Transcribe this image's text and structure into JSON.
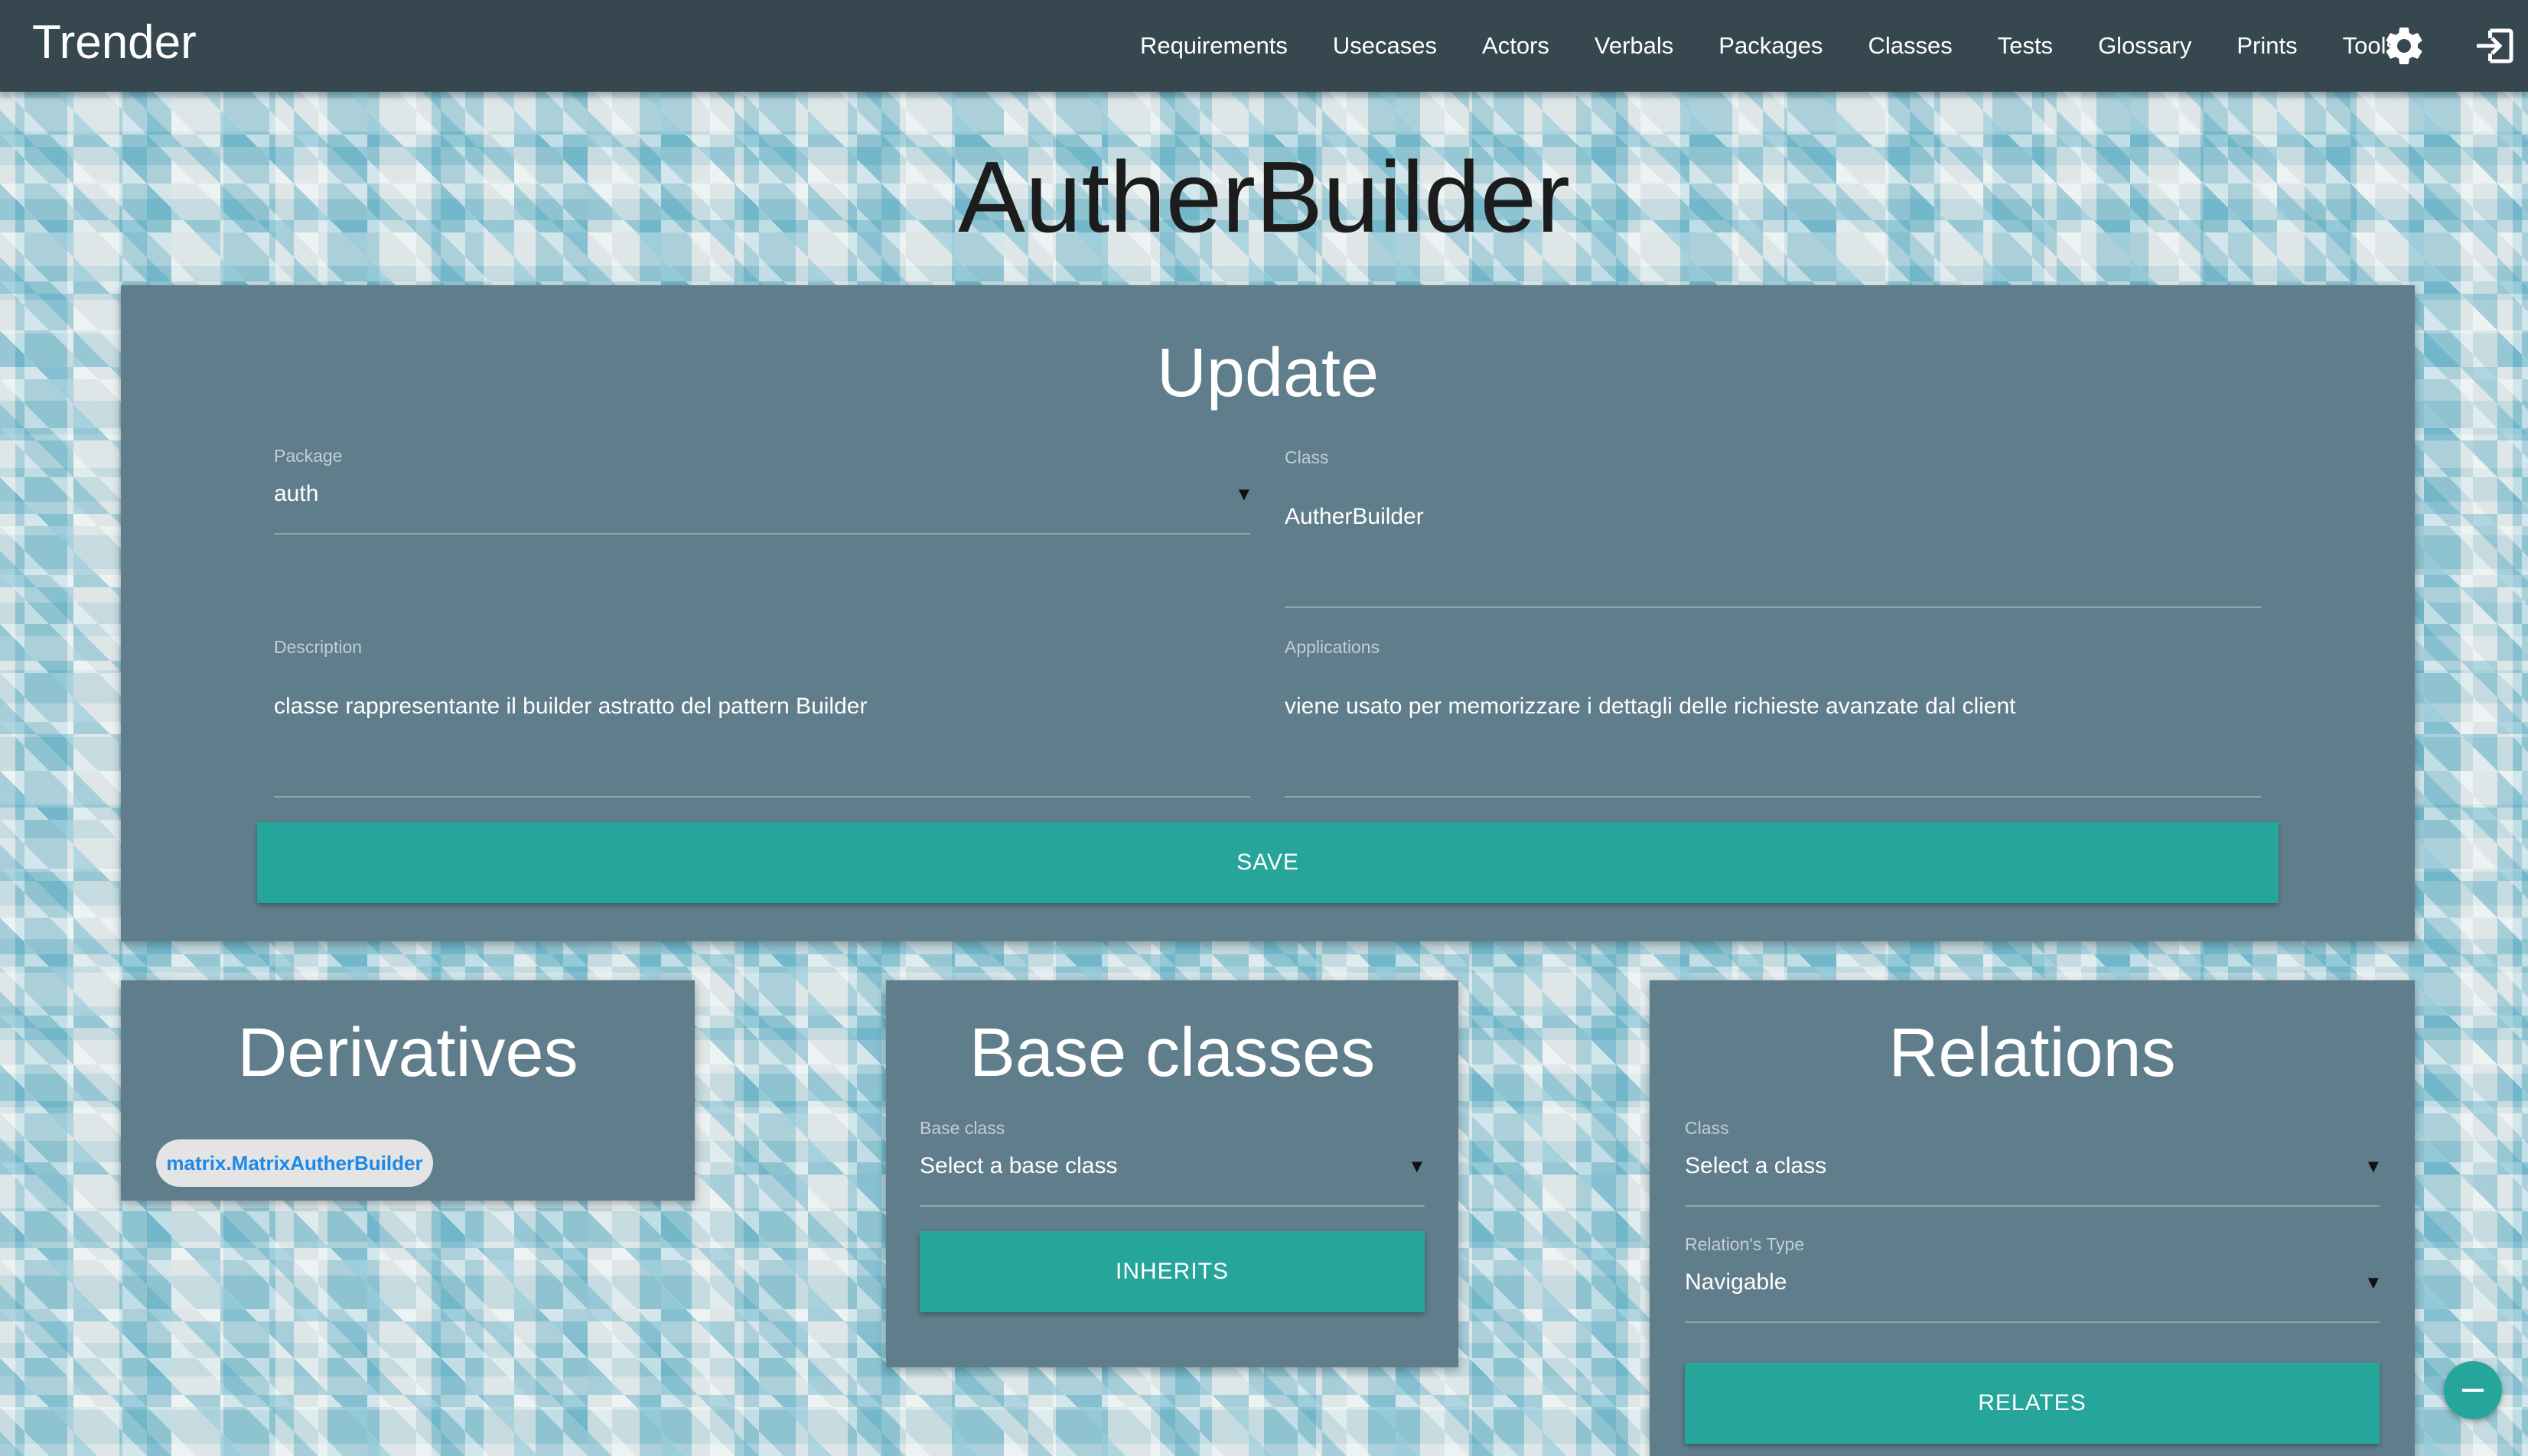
{
  "app": {
    "brand": "Trender"
  },
  "nav": {
    "items": [
      "Requirements",
      "Usecases",
      "Actors",
      "Verbals",
      "Packages",
      "Classes",
      "Tests",
      "Glossary",
      "Prints",
      "Tools"
    ],
    "icons": [
      "gear-icon",
      "logout-icon"
    ]
  },
  "page": {
    "title": "AutherBuilder"
  },
  "update": {
    "title": "Update",
    "package_label": "Package",
    "package_value": "auth",
    "class_label": "Class",
    "class_value": "AutherBuilder",
    "description_label": "Description",
    "description_value": "classe rappresentante il builder astratto del pattern Builder",
    "applications_label": "Applications",
    "applications_value": "viene usato per memorizzare i dettagli delle richieste avanzate dal client",
    "save_label": "SAVE"
  },
  "derivatives": {
    "title": "Derivatives",
    "items": [
      "matrix.MatrixAutherBuilder"
    ]
  },
  "base_classes": {
    "title": "Base classes",
    "field_label": "Base class",
    "field_value": "Select a base class",
    "button_label": "INHERITS"
  },
  "relations": {
    "title": "Relations",
    "class_label": "Class",
    "class_value": "Select a class",
    "type_label": "Relation's Type",
    "type_value": "Navigable",
    "button_label": "RELATES"
  },
  "colors": {
    "navbar": "#37474f",
    "card": "#607d8b",
    "accent": "#26a69a",
    "chip_text": "#1e88e5"
  }
}
